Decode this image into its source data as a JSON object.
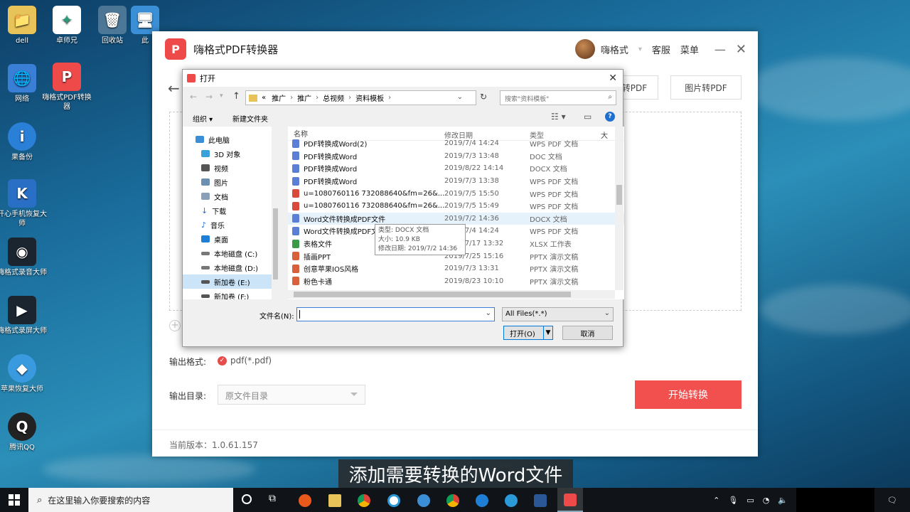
{
  "desktop": {
    "icons": [
      {
        "label": "dell",
        "icon": "user-folder-icon"
      },
      {
        "label": "卓师兄",
        "icon": "app-icon"
      },
      {
        "label": "回收站",
        "icon": "recycle-bin-icon"
      },
      {
        "label": "此",
        "icon": "computer-icon"
      },
      {
        "label": "网络",
        "icon": "network-icon"
      },
      {
        "label": "嗨格式PDF转换器",
        "icon": "pdf-app-icon"
      },
      {
        "label": "果备份",
        "icon": "backup-icon"
      },
      {
        "label": "开心手机恢复大师",
        "icon": "phone-recovery-icon"
      },
      {
        "label": "嗨格式录音大师",
        "icon": "recorder-icon"
      },
      {
        "label": "嗨格式录屏大师",
        "icon": "screen-recorder-icon"
      },
      {
        "label": "苹果恢复大师",
        "icon": "apple-recovery-icon"
      },
      {
        "label": "腾讯QQ",
        "icon": "qq-icon"
      }
    ]
  },
  "app": {
    "title": "嗨格式PDF转换器",
    "user": "嗨格式",
    "service": "客服",
    "menu": "菜单",
    "tab_partial": "转PDF",
    "tab_image": "图片转PDF",
    "output_format_label": "输出格式:",
    "output_format_value": "pdf(*.pdf)",
    "output_dir_label": "输出目录:",
    "output_dir_value": "原文件目录",
    "start_button": "开始转换",
    "version": "当前版本：1.0.61.157",
    "accent": "#f24f4f"
  },
  "dialog": {
    "title": "打开",
    "breadcrumb": [
      "«",
      "推广",
      "推广",
      "总视频",
      "资料模板"
    ],
    "search_placeholder": "搜索\"资料模板\"",
    "organize": "组织 ▾",
    "new_folder": "新建文件夹",
    "nav": [
      "此电脑",
      "3D 对象",
      "视频",
      "图片",
      "文档",
      "下载",
      "音乐",
      "桌面",
      "本地磁盘 (C:)",
      "本地磁盘 (D:)",
      "新加卷 (E:)",
      "新加卷 (F:)"
    ],
    "columns": {
      "name": "名称",
      "date": "修改日期",
      "type": "类型",
      "size": "大"
    },
    "files": [
      {
        "name": "PDF转换成Word(2)",
        "date": "2019/7/4 14:24",
        "type": "WPS PDF 文档",
        "color": "#5b7fd6"
      },
      {
        "name": "PDF转换成Word",
        "date": "2019/7/3 13:48",
        "type": "DOC 文档",
        "color": "#5b7fd6"
      },
      {
        "name": "PDF转换成Word",
        "date": "2019/8/22 14:14",
        "type": "DOCX 文档",
        "color": "#5b7fd6"
      },
      {
        "name": "PDF转换成Word",
        "date": "2019/7/3 13:38",
        "type": "WPS PDF 文档",
        "color": "#5b7fd6"
      },
      {
        "name": "u=1080760116 732088640&fm=26&...",
        "date": "2019/7/5 15:50",
        "type": "WPS PDF 文档",
        "color": "#d94a3d"
      },
      {
        "name": "u=1080760116 732088640&fm=26&...",
        "date": "2019/7/5 15:49",
        "type": "WPS PDF 文档",
        "color": "#d94a3d"
      },
      {
        "name": "Word文件转换成PDF文件",
        "date": "2019/7/2 14:36",
        "type": "DOCX 文档",
        "color": "#5b7fd6"
      },
      {
        "name": "Word文件转换成PDF文件",
        "date": "2019/7/4 14:24",
        "type": "WPS PDF 文档",
        "color": "#5b7fd6"
      },
      {
        "name": "表格文件",
        "date": "2019/7/17 13:32",
        "type": "XLSX 工作表",
        "color": "#3a9a4a"
      },
      {
        "name": "插画PPT",
        "date": "2019/7/25 15:16",
        "type": "PPTX 演示文稿",
        "color": "#d9603d"
      },
      {
        "name": "创意苹果IOS风格",
        "date": "2019/7/3 13:31",
        "type": "PPTX 演示文稿",
        "color": "#d9603d"
      },
      {
        "name": "粉色卡通",
        "date": "2019/8/23 10:10",
        "type": "PPTX 演示文稿",
        "color": "#d9603d"
      }
    ],
    "tooltip": {
      "type": "类型: DOCX 文档",
      "size": "大小: 10.9 KB",
      "modified": "修改日期: 2019/7/2 14:36"
    },
    "filename_label": "文件名(N):",
    "filename_value": "",
    "filter": "All Files(*.*)",
    "open_button": "打开(O)",
    "cancel_button": "取消"
  },
  "subtitle": "添加需要转换的Word文件",
  "taskbar": {
    "search_placeholder": "在这里输入你要搜索的内容"
  }
}
